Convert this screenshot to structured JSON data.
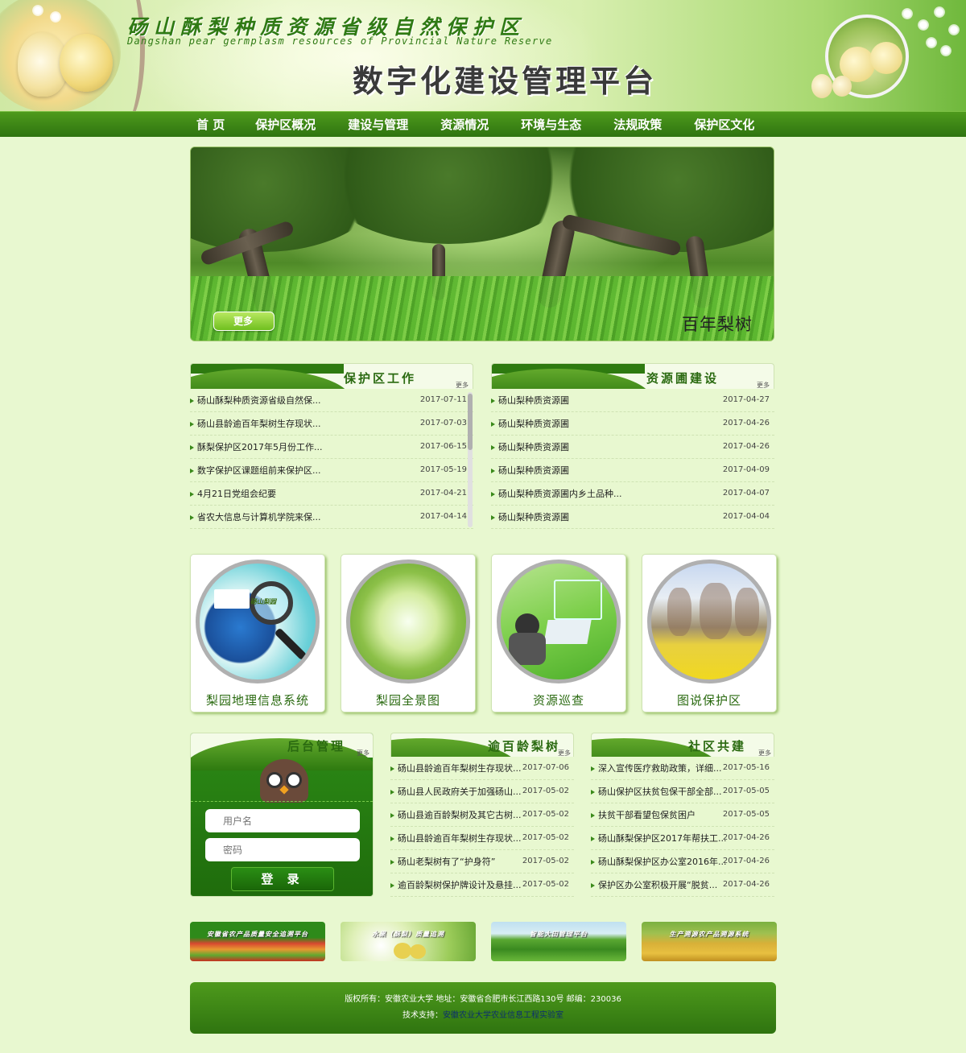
{
  "header": {
    "title_cn": "砀山酥梨种质资源省级自然保护区",
    "title_en": "Dangshan pear germplasm resources of Provincial Nature Reserve",
    "title_main": "数字化建设管理平台"
  },
  "nav": {
    "items": [
      "首 页",
      "保护区概况",
      "建设与管理",
      "资源情况",
      "环境与生态",
      "法规政策",
      "保护区文化"
    ]
  },
  "banner": {
    "more_label": "更多",
    "caption": "百年梨树"
  },
  "panel_work": {
    "title": "保护区工作",
    "more": "更多",
    "items": [
      {
        "text": "砀山酥梨种质资源省级自然保...",
        "date": "2017-07-11"
      },
      {
        "text": "砀山县龄逾百年梨树生存现状...",
        "date": "2017-07-03"
      },
      {
        "text": "酥梨保护区2017年5月份工作...",
        "date": "2017-06-15"
      },
      {
        "text": "数字保护区课题组前来保护区...",
        "date": "2017-05-19"
      },
      {
        "text": "4月21日党组会纪要",
        "date": "2017-04-21"
      },
      {
        "text": "省农大信息与计算机学院来保...",
        "date": "2017-04-14"
      }
    ]
  },
  "panel_nursery": {
    "title": "资源圃建设",
    "more": "更多",
    "items": [
      {
        "text": "砀山梨种质资源圃",
        "date": "2017-04-27"
      },
      {
        "text": "砀山梨种质资源圃",
        "date": "2017-04-26"
      },
      {
        "text": "砀山梨种质资源圃",
        "date": "2017-04-26"
      },
      {
        "text": "砀山梨种质资源圃",
        "date": "2017-04-09"
      },
      {
        "text": "砀山梨种质资源圃内乡土品种...",
        "date": "2017-04-07"
      },
      {
        "text": "砀山梨种质资源圃",
        "date": "2017-04-04"
      }
    ]
  },
  "cards": [
    {
      "label": "梨园地理信息系统",
      "map_text": "砀山梨园"
    },
    {
      "label": "梨园全景图"
    },
    {
      "label": "资源巡查"
    },
    {
      "label": "图说保护区"
    }
  ],
  "login": {
    "title": "后台管理",
    "more": "更多",
    "username_placeholder": "用户名",
    "password_placeholder": "密码",
    "button": "登 录"
  },
  "panel_trees": {
    "title": "逾百龄梨树",
    "more": "更多",
    "items": [
      {
        "text": "砀山县龄逾百年梨树生存现状...",
        "date": "2017-07-06"
      },
      {
        "text": "砀山县人民政府关于加强砀山...",
        "date": "2017-05-02"
      },
      {
        "text": "砀山县逾百龄梨树及其它古树...",
        "date": "2017-05-02"
      },
      {
        "text": "砀山县龄逾百年梨树生存现状...",
        "date": "2017-05-02"
      },
      {
        "text": "砀山老梨树有了“护身符”",
        "date": "2017-05-02"
      },
      {
        "text": "逾百龄梨树保护牌设计及悬挂...",
        "date": "2017-05-02"
      }
    ]
  },
  "panel_community": {
    "title": "社区共建",
    "more": "更多",
    "items": [
      {
        "text": "深入宣传医疗救助政策，详细...",
        "date": "2017-05-16"
      },
      {
        "text": "砀山保护区扶贫包保干部全部...",
        "date": "2017-05-05"
      },
      {
        "text": "扶贫干部看望包保贫困户",
        "date": "2017-05-05"
      },
      {
        "text": "砀山酥梨保护区2017年帮扶工...",
        "date": "2017-04-26"
      },
      {
        "text": "砀山酥梨保护区办公室2016年...",
        "date": "2017-04-26"
      },
      {
        "text": "保护区办公室积极开展“脱贫...",
        "date": "2017-04-26"
      }
    ]
  },
  "links": [
    {
      "text": "安徽省农产品质量安全追溯平台"
    },
    {
      "text": "水果（酥梨）质量追溯"
    },
    {
      "text": "智能大田管理平台"
    },
    {
      "text": "生产溯源农产品溯源系统"
    }
  ],
  "footer": {
    "line1": "版权所有：安徽农业大学   地址：安徽省合肥市长江西路130号   邮编：230036",
    "line2_prefix": "技术支持：",
    "line2_link": "安徽农业大学农业信息工程实验室"
  }
}
